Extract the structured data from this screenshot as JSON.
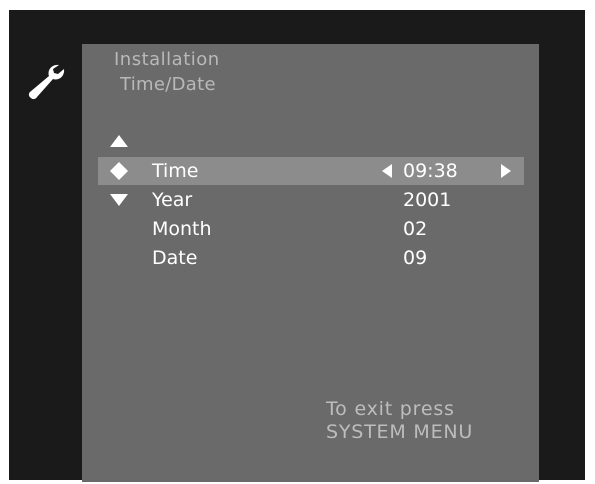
{
  "menu": {
    "title": "Installation",
    "subtitle": "Time/Date",
    "items": [
      {
        "label": "Time",
        "value": "09:38"
      },
      {
        "label": "Year",
        "value": "2001"
      },
      {
        "label": "Month",
        "value": "02"
      },
      {
        "label": "Date",
        "value": "09"
      }
    ],
    "selected_item": "Time"
  },
  "hint": {
    "line1": "To exit press",
    "line2": "SYSTEM MENU"
  },
  "icons": {
    "settings": "wrench-icon",
    "scroll_up": "triangle-up-icon",
    "scroll_down": "triangle-down-icon",
    "selected_marker": "diamond-icon",
    "value_decrease": "triangle-left-icon",
    "value_increase": "triangle-right-icon"
  },
  "colors": {
    "screen_background": "#1a1a1a",
    "panel_background": "#6a6a6a",
    "highlight_background": "#8c8c8c",
    "item_text": "#ffffff",
    "header_text": "#b9b9b9"
  }
}
